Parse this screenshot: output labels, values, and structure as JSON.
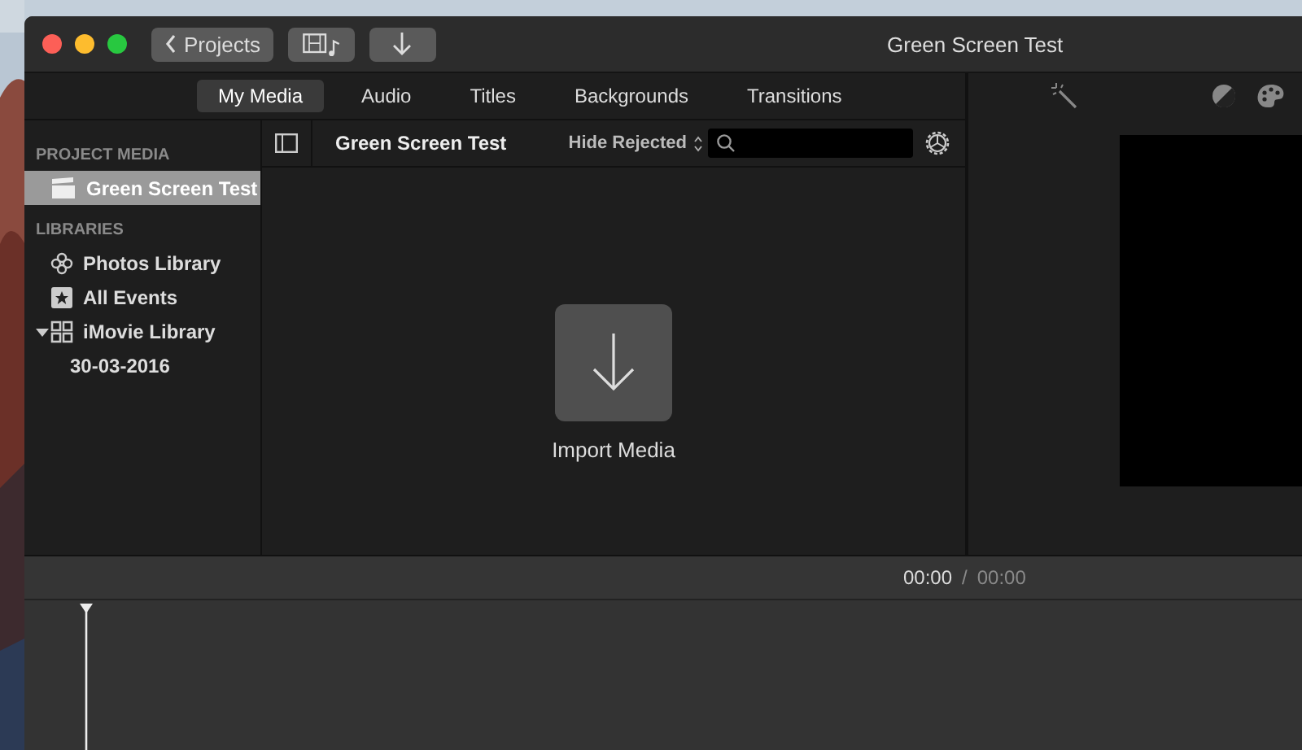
{
  "window": {
    "title": "Green Screen Test"
  },
  "toolbar": {
    "back_label": "Projects"
  },
  "tabs": [
    {
      "label": "My Media",
      "selected": true
    },
    {
      "label": "Audio",
      "selected": false
    },
    {
      "label": "Titles",
      "selected": false
    },
    {
      "label": "Backgrounds",
      "selected": false
    },
    {
      "label": "Transitions",
      "selected": false
    }
  ],
  "sidebar": {
    "sections": [
      {
        "heading": "PROJECT MEDIA",
        "items": [
          {
            "label": "Green Screen Test",
            "kind": "project",
            "selected": true
          }
        ]
      },
      {
        "heading": "LIBRARIES",
        "items": [
          {
            "label": "Photos Library",
            "kind": "photos",
            "selected": false
          },
          {
            "label": "All Events",
            "kind": "events",
            "selected": false
          },
          {
            "label": "iMovie Library",
            "kind": "library",
            "selected": false,
            "expanded": true,
            "children": [
              {
                "label": "30-03-2016",
                "selected": false
              }
            ]
          }
        ]
      }
    ]
  },
  "browser": {
    "title": "Green Screen Test",
    "filter": "Hide Rejected",
    "import_label": "Import Media"
  },
  "timeline": {
    "current": "00:00",
    "separator": "/",
    "total": "00:00"
  }
}
